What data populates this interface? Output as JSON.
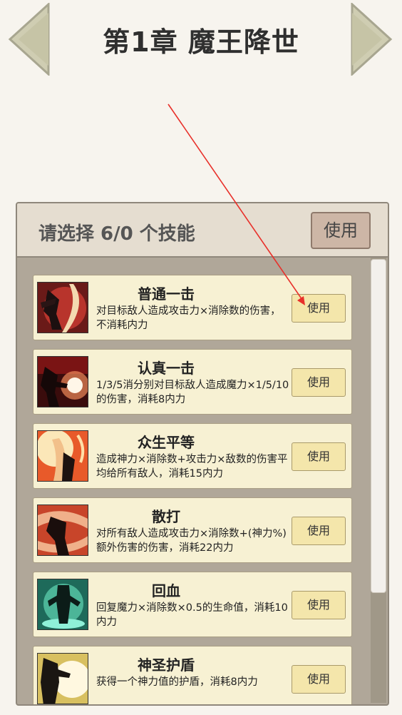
{
  "chapter_title": "第1章 魔王降世",
  "panel": {
    "title": "请选择 6/0 个技能",
    "use_label": "使用"
  },
  "skills": [
    {
      "name": "普通一击",
      "desc": "对目标敌人造成攻击力×消除数的伤害，不消耗内力",
      "use_label": "使用",
      "icon": "strike-icon"
    },
    {
      "name": "认真一击",
      "desc": "1/3/5消分别对目标敌人造成魔力×1/5/10的伤害，消耗8内力",
      "use_label": "使用",
      "icon": "serious-strike-icon"
    },
    {
      "name": "众生平等",
      "desc": "造成神力×消除数+攻击力×敌数的伤害平均给所有敌人，消耗15内力",
      "use_label": "使用",
      "icon": "equality-icon"
    },
    {
      "name": "散打",
      "desc": "对所有敌人造成攻击力×消除数+(神力%)额外伤害的伤害，消耗22内力",
      "use_label": "使用",
      "icon": "brawl-icon"
    },
    {
      "name": "回血",
      "desc": "回复魔力×消除数×0.5的生命值，消耗10内力",
      "use_label": "使用",
      "icon": "heal-icon"
    },
    {
      "name": "神圣护盾",
      "desc": "获得一个神力值的护盾，消耗8内力",
      "use_label": "使用",
      "icon": "holy-shield-icon"
    }
  ],
  "colors": {
    "background": "#f7f4ee",
    "panel": "#b0a799",
    "card": "#f7f1d3",
    "card_button": "#f4e6ab",
    "header_button": "#cdb6a6",
    "annotation_arrow": "#e8302a"
  }
}
